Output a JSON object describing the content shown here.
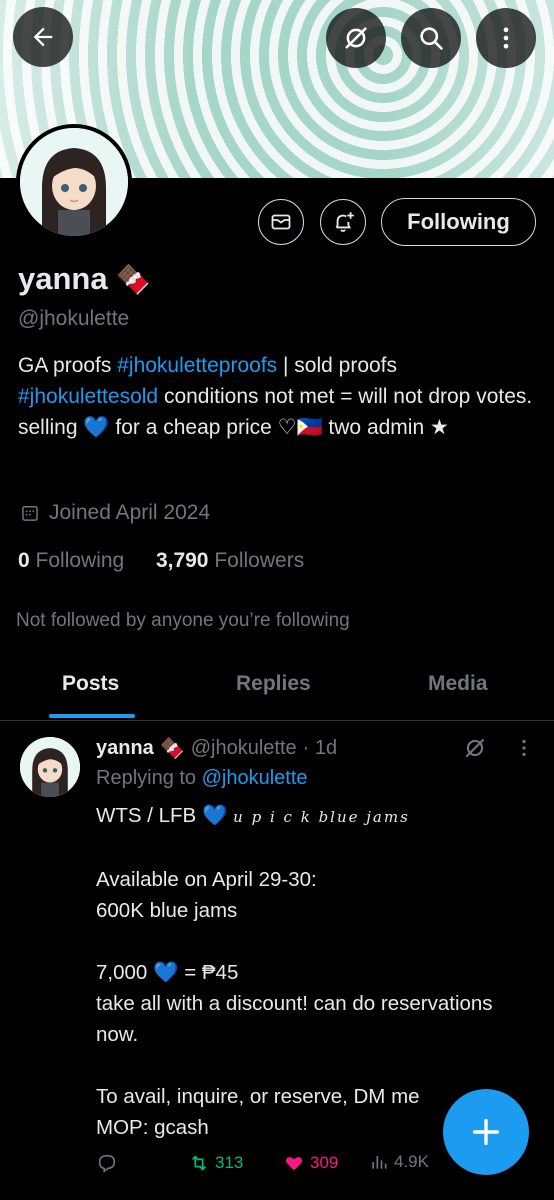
{
  "banner": {
    "description_colors": [
      "#a6d6c8",
      "#f1f7f4"
    ]
  },
  "header_icons": [
    "back-arrow-icon",
    "grok-icon",
    "search-icon",
    "more-vertical-icon"
  ],
  "profile": {
    "name": "yanna",
    "emoji": "🍫",
    "handle": "@jhokulette",
    "bio": {
      "p1": "GA proofs ",
      "tag1": "#jhokuletteproofs",
      "p2": " | sold proofs ",
      "tag2": "#jhokulettesold",
      "p3": " conditions not met = will not drop votes. selling ",
      "heart": "💙",
      "p4": " for a cheap price ♡🇵🇭 two admin ★"
    },
    "joined": "Joined April 2024",
    "following_count": "0",
    "following_label": "Following",
    "followers_count": "3,790",
    "followers_label": "Followers",
    "not_followed": "Not followed by anyone you’re following",
    "follow_button": "Following"
  },
  "tabs": [
    {
      "label": "Posts",
      "active": true
    },
    {
      "label": "Replies",
      "active": false
    },
    {
      "label": "Media",
      "active": false
    }
  ],
  "post": {
    "name": "yanna",
    "emoji": "🍫",
    "handle": "@jhokulette",
    "time": "· 1d",
    "replying_prefix": "Replying to ",
    "replying_handle": "@jhokulette",
    "line1_prefix": "WTS / LFB ",
    "line1_heart": "💙",
    "line1_fancy": "u p i c k  blue jams",
    "body": "\nAvailable on April 29-30:\n600K blue jams\n\n7,000 💙 = ₱45\ntake all with a discount! can do reservations now.\n\nTo avail, inquire, or reserve, DM me\nMOP: gcash",
    "retweets": "313",
    "likes": "309",
    "views": "4.9K"
  },
  "colors": {
    "accent": "#1d9bf0",
    "retweet": "#00ba7c",
    "like": "#f91880",
    "muted": "#71767b"
  }
}
